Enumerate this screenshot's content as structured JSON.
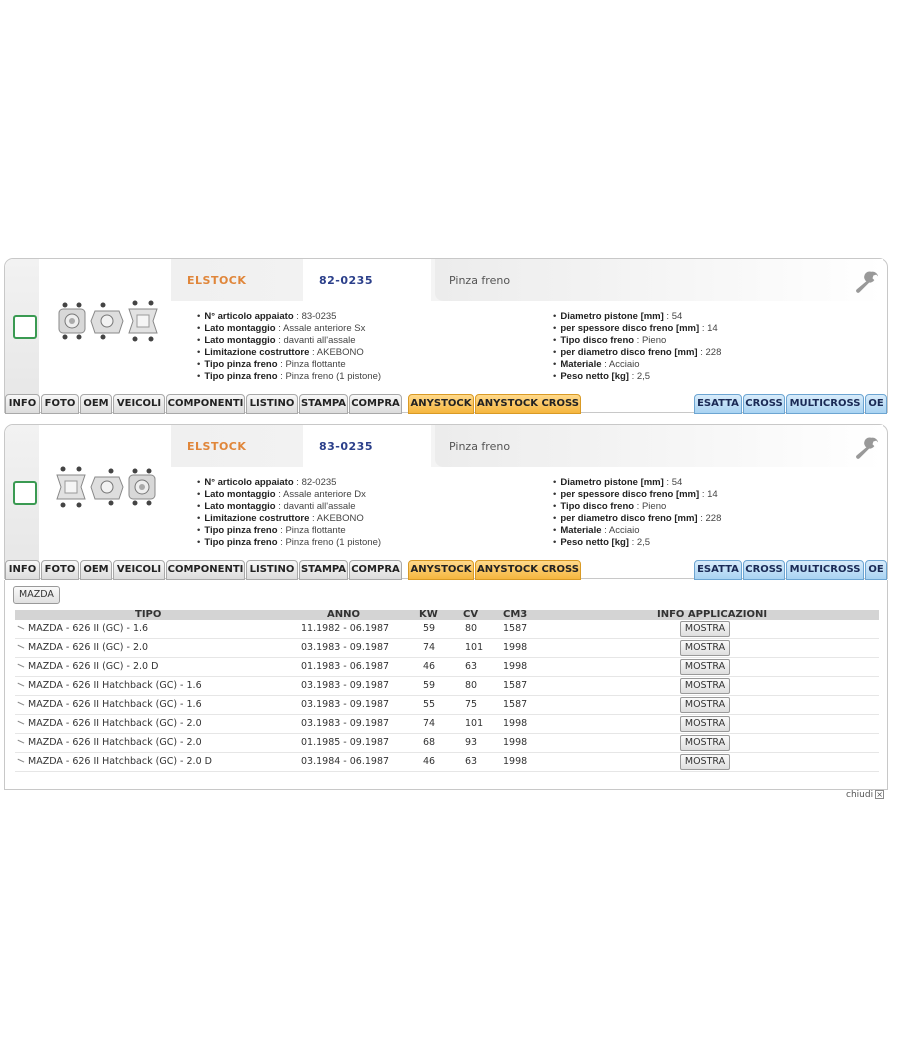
{
  "products": [
    {
      "brand": "ELSTOCK",
      "code": "82-0235",
      "description": "Pinza freno",
      "props_left": [
        {
          "label": "N° articolo appaiato",
          "value": "83-0235"
        },
        {
          "label": "Lato montaggio",
          "value": "Assale anteriore Sx"
        },
        {
          "label": "Lato montaggio",
          "value": "davanti all'assale"
        },
        {
          "label": "Limitazione costruttore",
          "value": "AKEBONO"
        },
        {
          "label": "Tipo pinza freno",
          "value": "Pinza flottante"
        },
        {
          "label": "Tipo pinza freno",
          "value": "Pinza freno (1 pistone)"
        }
      ],
      "props_right": [
        {
          "label": "Diametro pistone [mm]",
          "value": "54"
        },
        {
          "label": "per spessore disco freno [mm]",
          "value": "14"
        },
        {
          "label": "Tipo disco freno",
          "value": "Pieno"
        },
        {
          "label": "per diametro disco freno [mm]",
          "value": "228"
        },
        {
          "label": "Materiale",
          "value": "Acciaio"
        },
        {
          "label": "Peso netto [kg]",
          "value": "2,5"
        }
      ]
    },
    {
      "brand": "ELSTOCK",
      "code": "83-0235",
      "description": "Pinza freno",
      "props_left": [
        {
          "label": "N° articolo appaiato",
          "value": "82-0235"
        },
        {
          "label": "Lato montaggio",
          "value": "Assale anteriore Dx"
        },
        {
          "label": "Lato montaggio",
          "value": "davanti all'assale"
        },
        {
          "label": "Limitazione costruttore",
          "value": "AKEBONO"
        },
        {
          "label": "Tipo pinza freno",
          "value": "Pinza flottante"
        },
        {
          "label": "Tipo pinza freno",
          "value": "Pinza freno (1 pistone)"
        }
      ],
      "props_right": [
        {
          "label": "Diametro pistone [mm]",
          "value": "54"
        },
        {
          "label": "per spessore disco freno [mm]",
          "value": "14"
        },
        {
          "label": "Tipo disco freno",
          "value": "Pieno"
        },
        {
          "label": "per diametro disco freno [mm]",
          "value": "228"
        },
        {
          "label": "Materiale",
          "value": "Acciaio"
        },
        {
          "label": "Peso netto [kg]",
          "value": "2,5"
        }
      ]
    }
  ],
  "tabs": {
    "info": "INFO",
    "foto": "FOTO",
    "oem": "OEM",
    "veicoli": "VEICOLI",
    "componenti": "COMPONENTI",
    "listino": "LISTINO",
    "stampa": "STAMPA",
    "compra": "COMPRA",
    "anystock": "ANYSTOCK",
    "anystock_cross": "ANYSTOCK CROSS",
    "esatta": "ESATTA",
    "cross": "CROSS",
    "multicross": "MULTICROSS",
    "oe": "OE"
  },
  "applications": {
    "make_button": "MAZDA",
    "headers": {
      "tipo": "TIPO",
      "anno": "ANNO",
      "kw": "KW",
      "cv": "CV",
      "cm3": "CM3",
      "info": "INFO APPLICAZIONI"
    },
    "button_label": "MOSTRA",
    "rows": [
      {
        "tipo": "MAZDA - 626 II (GC) - 1.6",
        "anno": "11.1982 - 06.1987",
        "kw": "59",
        "cv": "80",
        "cm3": "1587"
      },
      {
        "tipo": "MAZDA - 626 II (GC) - 2.0",
        "anno": "03.1983 - 09.1987",
        "kw": "74",
        "cv": "101",
        "cm3": "1998"
      },
      {
        "tipo": "MAZDA - 626 II (GC) - 2.0 D",
        "anno": "01.1983 - 06.1987",
        "kw": "46",
        "cv": "63",
        "cm3": "1998"
      },
      {
        "tipo": "MAZDA - 626 II Hatchback (GC) - 1.6",
        "anno": "03.1983 - 09.1987",
        "kw": "59",
        "cv": "80",
        "cm3": "1587"
      },
      {
        "tipo": "MAZDA - 626 II Hatchback (GC) - 1.6",
        "anno": "03.1983 - 09.1987",
        "kw": "55",
        "cv": "75",
        "cm3": "1587"
      },
      {
        "tipo": "MAZDA - 626 II Hatchback (GC) - 2.0",
        "anno": "03.1983 - 09.1987",
        "kw": "74",
        "cv": "101",
        "cm3": "1998"
      },
      {
        "tipo": "MAZDA - 626 II Hatchback (GC) - 2.0",
        "anno": "01.1985 - 09.1987",
        "kw": "68",
        "cv": "93",
        "cm3": "1998"
      },
      {
        "tipo": "MAZDA - 626 II Hatchback (GC) - 2.0 D",
        "anno": "03.1984 - 06.1987",
        "kw": "46",
        "cv": "63",
        "cm3": "1998"
      }
    ]
  },
  "close_label": "chiudi",
  "colors": {
    "brand": "#e0863a",
    "code": "#2b3f8a",
    "checkbox": "#3a9a52",
    "tab_orange": "#f5b63f",
    "tab_blue": "#a9d3f2"
  }
}
